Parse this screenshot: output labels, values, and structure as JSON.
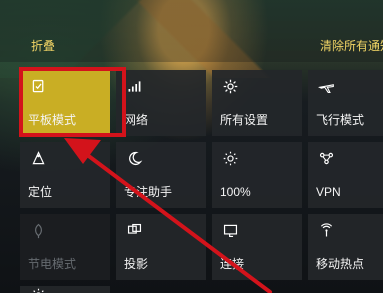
{
  "header": {
    "collapse": "折叠",
    "clear_all": "清除所有通知"
  },
  "tiles": [
    {
      "label": "平板模式",
      "icon": "tablet-mode-icon"
    },
    {
      "label": "网络",
      "icon": "network-icon"
    },
    {
      "label": "所有设置",
      "icon": "settings-gear-icon"
    },
    {
      "label": "飞行模式",
      "icon": "airplane-icon"
    },
    {
      "label": "定位",
      "icon": "location-icon"
    },
    {
      "label": "专注助手",
      "icon": "moon-icon"
    },
    {
      "label": "100%",
      "icon": "brightness-icon"
    },
    {
      "label": "VPN",
      "icon": "vpn-icon"
    },
    {
      "label": "节电模式",
      "icon": "battery-saver-icon"
    },
    {
      "label": "投影",
      "icon": "project-icon"
    },
    {
      "label": "连接",
      "icon": "connect-icon"
    },
    {
      "label": "移动热点",
      "icon": "hotspot-icon"
    },
    {
      "label": "",
      "icon": "sun-icon"
    }
  ],
  "colors": {
    "accent": "#c9ae24",
    "highlight": "#d3131b",
    "link": "#f1d465"
  }
}
